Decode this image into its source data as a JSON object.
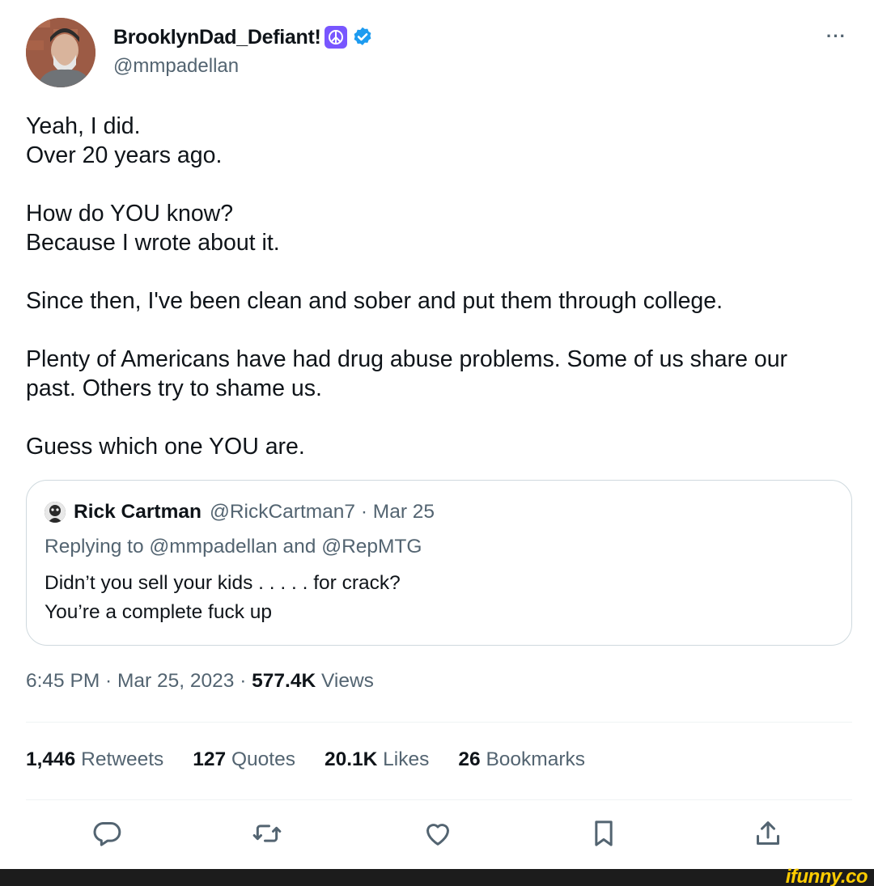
{
  "author": {
    "display_name": "BrooklynDad_Defiant!",
    "handle": "@mmpadellan",
    "avatar_icon": "avatar-photo",
    "badges": [
      "peace-icon",
      "verified-icon"
    ]
  },
  "more_label": "···",
  "tweet": {
    "paragraphs": [
      "Yeah, I did.\nOver 20 years ago.",
      "How do YOU know?\nBecause I wrote about it.",
      "Since then, I've been clean and sober and put them through college.",
      "Plenty of Americans have had drug abuse problems. Some of us share our past. Others try to shame us.",
      "Guess which one YOU are."
    ]
  },
  "quote": {
    "name": "Rick Cartman",
    "meta": "@RickCartman7 · Mar 25",
    "replying": "Replying to @mmpadellan and @RepMTG",
    "body": "Didn’t you sell your kids . . . . . for crack?\nYou’re a complete fuck up"
  },
  "timestamp": {
    "time_date": "6:45 PM · Mar 25, 2023 · ",
    "views_count": "577.4K",
    "views_label": " Views"
  },
  "stats": [
    {
      "count": "1,446",
      "label": "Retweets"
    },
    {
      "count": "127",
      "label": "Quotes"
    },
    {
      "count": "20.1K",
      "label": "Likes"
    },
    {
      "count": "26",
      "label": "Bookmarks"
    }
  ],
  "actions": [
    "reply-icon",
    "retweet-icon",
    "like-icon",
    "bookmark-icon",
    "share-icon"
  ],
  "watermark": "ifunny.co",
  "colors": {
    "text": "#0f1419",
    "muted": "#536471",
    "verified": "#1d9bf0",
    "peace_badge": "#7856ff",
    "border": "#cfd9de",
    "watermark": "#ffcc00"
  }
}
